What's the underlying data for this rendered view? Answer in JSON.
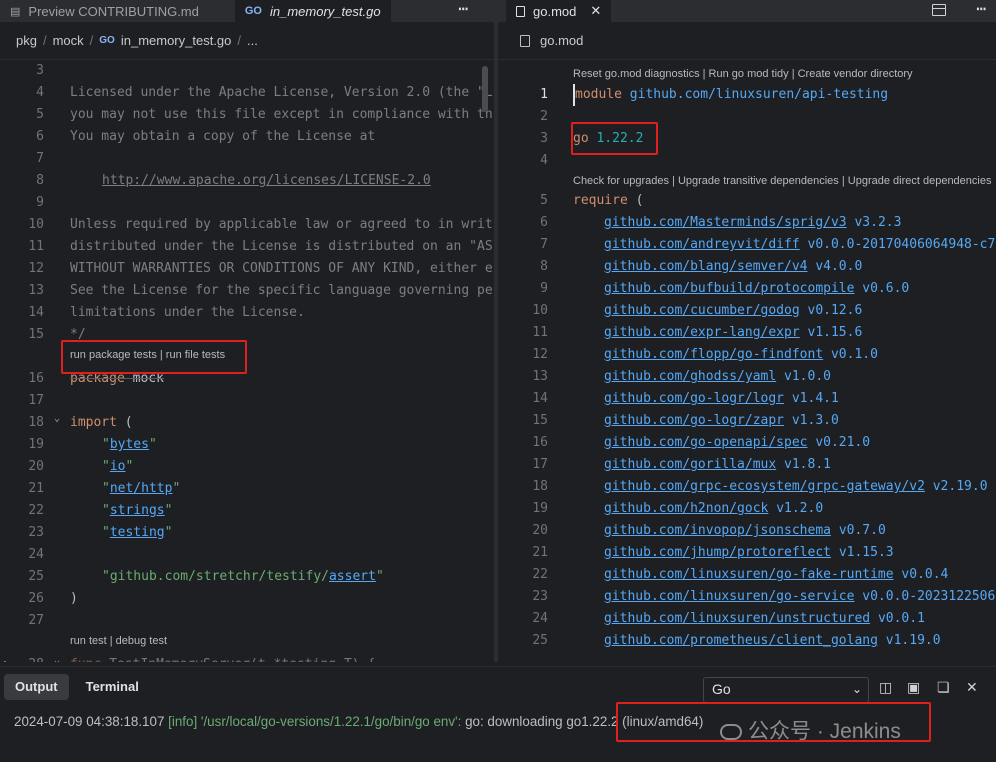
{
  "left_pane": {
    "tabs": [
      {
        "icon": "preview-icon",
        "label": "Preview CONTRIBUTING.md",
        "active": false
      },
      {
        "icon": "go-file-icon",
        "label": "in_memory_test.go",
        "active": true
      }
    ],
    "more": "⋯",
    "breadcrumb": [
      "pkg",
      "mock",
      "in_memory_test.go",
      "..."
    ],
    "lenses": {
      "package": "run package tests | run file tests",
      "test": "run test | debug test"
    },
    "lines": [
      {
        "n": "3",
        "text": ""
      },
      {
        "n": "4",
        "text": "Licensed under the Apache License, Version 2.0 (the \"L"
      },
      {
        "n": "5",
        "text": "you may not use this file except in compliance with th"
      },
      {
        "n": "6",
        "text": "You may obtain a copy of the License at"
      },
      {
        "n": "7",
        "text": ""
      },
      {
        "n": "8",
        "text": "http://www.apache.org/licenses/LICENSE-2.0"
      },
      {
        "n": "9",
        "text": ""
      },
      {
        "n": "10",
        "text": "Unless required by applicable law or agreed to in writ"
      },
      {
        "n": "11",
        "text": "distributed under the License is distributed on an \"AS"
      },
      {
        "n": "12",
        "text": "WITHOUT WARRANTIES OR CONDITIONS OF ANY KIND, either e"
      },
      {
        "n": "13",
        "text": "See the License for the specific language governing pe"
      },
      {
        "n": "14",
        "text": "limitations under the License."
      },
      {
        "n": "15",
        "text": "*/"
      },
      {
        "n": "16",
        "kw": "package",
        "rest": " mock"
      },
      {
        "n": "17",
        "text": ""
      },
      {
        "n": "18",
        "kw": "import",
        "rest": " ("
      },
      {
        "n": "19",
        "pkg": "bytes"
      },
      {
        "n": "20",
        "pkg": "io"
      },
      {
        "n": "21",
        "pkg": "net/http"
      },
      {
        "n": "22",
        "pkg": "strings"
      },
      {
        "n": "23",
        "pkg": "testing"
      },
      {
        "n": "24",
        "text": ""
      },
      {
        "n": "25",
        "pre": "github.com/stretchr/testify/",
        "pkg": "assert"
      },
      {
        "n": "26",
        "text": ")"
      },
      {
        "n": "27",
        "text": ""
      },
      {
        "n": "28",
        "kw": "func",
        "rest": " TestInMemoryServer(t *testing.T) {"
      }
    ]
  },
  "right_pane": {
    "tabs": [
      {
        "icon": "file-icon",
        "label": "go.mod",
        "close": "✕"
      }
    ],
    "more": "⋯",
    "breadcrumb": "go.mod",
    "lenses": {
      "module": "Reset go.mod diagnostics | Run go mod tidy | Create vendor directory",
      "require": "Check for upgrades | Upgrade transitive dependencies | Upgrade direct dependencies"
    },
    "module_line": {
      "n": "1",
      "kw": "module",
      "path": "github.com/linuxsuren/api-testing"
    },
    "go_line": {
      "n": "3",
      "kw": "go",
      "version": "1.22.2"
    },
    "require_line": {
      "n": "5",
      "kw": "require",
      "rest": " ("
    },
    "deps": [
      {
        "n": "6",
        "path": "github.com/Masterminds/sprig/v3",
        "version": "v3.2.3"
      },
      {
        "n": "7",
        "path": "github.com/andreyvit/diff",
        "version": "v0.0.0-20170406064948-c7"
      },
      {
        "n": "8",
        "path": "github.com/blang/semver/v4",
        "version": "v4.0.0"
      },
      {
        "n": "9",
        "path": "github.com/bufbuild/protocompile",
        "version": "v0.6.0"
      },
      {
        "n": "10",
        "path": "github.com/cucumber/godog",
        "version": "v0.12.6"
      },
      {
        "n": "11",
        "path": "github.com/expr-lang/expr",
        "version": "v1.15.6"
      },
      {
        "n": "12",
        "path": "github.com/flopp/go-findfont",
        "version": "v0.1.0"
      },
      {
        "n": "13",
        "path": "github.com/ghodss/yaml",
        "version": "v1.0.0"
      },
      {
        "n": "14",
        "path": "github.com/go-logr/logr",
        "version": "v1.4.1"
      },
      {
        "n": "15",
        "path": "github.com/go-logr/zapr",
        "version": "v1.3.0"
      },
      {
        "n": "16",
        "path": "github.com/go-openapi/spec",
        "version": "v0.21.0"
      },
      {
        "n": "17",
        "path": "github.com/gorilla/mux",
        "version": "v1.8.1"
      },
      {
        "n": "18",
        "path": "github.com/grpc-ecosystem/grpc-gateway/v2",
        "version": "v2.19.0"
      },
      {
        "n": "19",
        "path": "github.com/h2non/gock",
        "version": "v1.2.0"
      },
      {
        "n": "20",
        "path": "github.com/invopop/jsonschema",
        "version": "v0.7.0"
      },
      {
        "n": "21",
        "path": "github.com/jhump/protoreflect",
        "version": "v1.15.3"
      },
      {
        "n": "22",
        "path": "github.com/linuxsuren/go-fake-runtime",
        "version": "v0.0.4"
      },
      {
        "n": "23",
        "path": "github.com/linuxsuren/go-service",
        "version": "v0.0.0-2023122506"
      },
      {
        "n": "24",
        "path": "github.com/linuxsuren/unstructured",
        "version": "v0.0.1"
      },
      {
        "n": "25",
        "path": "github.com/prometheus/client_golang",
        "version": "v1.19.0"
      }
    ]
  },
  "bottom_panel": {
    "tabs": [
      {
        "label": "Output",
        "active": true
      },
      {
        "label": "Terminal",
        "active": false
      }
    ],
    "selected_output": "Go",
    "output_line": {
      "timestamp": "2024-07-09 04:38:18.107",
      "level": "[info]",
      "message": "'/usr/local/go-versions/1.22.1/go/bin/go env':",
      "tail": "go: downloading go1.22.2 (linux/amd64)"
    },
    "watermark": "公众号 · Jenkins"
  }
}
